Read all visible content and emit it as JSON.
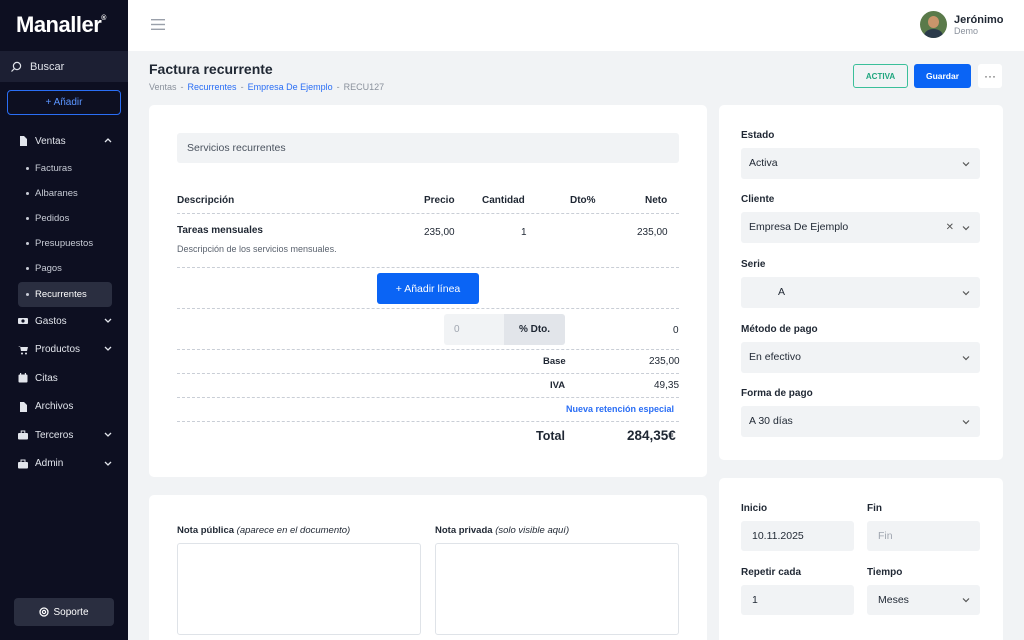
{
  "brand": {
    "logo": "Manaller",
    "mark": "®"
  },
  "sidebar": {
    "search_label": "Buscar",
    "add_label": "+ Añadir",
    "items": [
      {
        "label": "Ventas",
        "icon": "file-icon"
      },
      {
        "label": "Facturas"
      },
      {
        "label": "Albaranes"
      },
      {
        "label": "Pedidos"
      },
      {
        "label": "Presupuestos"
      },
      {
        "label": "Pagos"
      },
      {
        "label": "Recurrentes"
      },
      {
        "label": "Gastos",
        "icon": "money-icon"
      },
      {
        "label": "Productos",
        "icon": "cart-icon"
      },
      {
        "label": "Citas",
        "icon": "calendar-icon"
      },
      {
        "label": "Archivos",
        "icon": "document-icon"
      },
      {
        "label": "Terceros",
        "icon": "briefcase-icon"
      },
      {
        "label": "Admin",
        "icon": "toolbox-icon"
      }
    ],
    "support_label": "Soporte"
  },
  "topbar": {
    "user_name": "Jerónimo",
    "user_role": "Demo"
  },
  "page": {
    "title": "Factura recurrente",
    "breadcrumb": [
      "Ventas",
      "Recurrentes",
      "Empresa De Ejemplo",
      "RECU127"
    ],
    "status_label": "ACTIVA",
    "save_label": "Guardar",
    "more_label": "···"
  },
  "invoice": {
    "section_title": "Servicios recurrentes",
    "columns": [
      "Descripción",
      "Precio",
      "Cantidad",
      "Dto%",
      "Neto"
    ],
    "line": {
      "title": "Tareas mensuales",
      "description": "Descripción de los servicios mensuales.",
      "price": "235,00",
      "qty": "1",
      "net": "235,00"
    },
    "add_line_label": "+ Añadir línea",
    "discount_placeholder": "0",
    "discount_button": "% Dto.",
    "discount_value": "0",
    "base_label": "Base",
    "base_value": "235,00",
    "iva_label": "IVA",
    "iva_value": "49,35",
    "retention_link": "Nueva retención especial",
    "total_label": "Total",
    "total_value": "284,35€"
  },
  "settings": {
    "estado_label": "Estado",
    "estado_value": "Activa",
    "cliente_label": "Cliente",
    "cliente_value": "Empresa De Ejemplo",
    "serie_label": "Serie",
    "serie_value": "A",
    "metodo_label": "Método de pago",
    "metodo_value": "En efectivo",
    "forma_label": "Forma de pago",
    "forma_value": "A 30 días"
  },
  "schedule": {
    "inicio_label": "Inicio",
    "inicio_value": "10.11.2025",
    "fin_label": "Fin",
    "fin_placeholder": "Fin",
    "repetir_label": "Repetir cada",
    "repetir_value": "1",
    "tiempo_label": "Tiempo",
    "tiempo_value": "Meses"
  },
  "notes": {
    "public_label": "Nota pública",
    "public_hint": "(aparece en el documento)",
    "private_label": "Nota privada",
    "private_hint": "(solo visible aquí)"
  }
}
